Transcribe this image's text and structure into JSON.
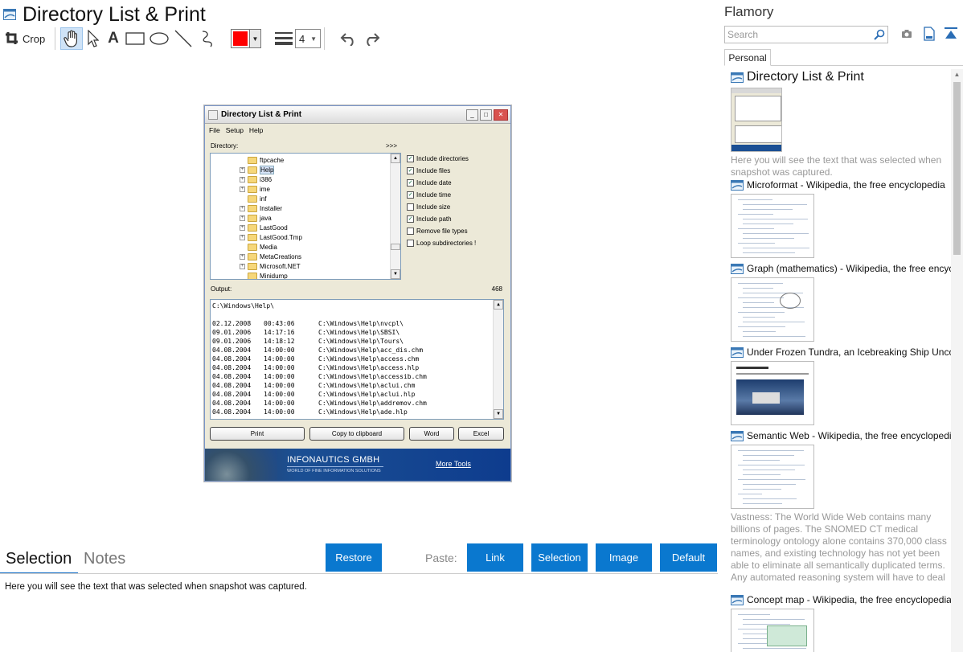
{
  "main": {
    "title": "Directory List & Print",
    "toolbar": {
      "crop_label": "Crop",
      "text_tool_glyph": "A",
      "line_width": "4",
      "color": "#ff0000"
    },
    "bottom": {
      "tab_selection": "Selection",
      "tab_notes": "Notes",
      "restore_label": "Restore",
      "paste_label": "Paste:",
      "paste_link": "Link",
      "paste_selection": "Selection",
      "paste_image": "Image",
      "paste_default": "Default",
      "selection_text": "Here you will see the text that was selected when snapshot was captured."
    }
  },
  "snapshot": {
    "title": "Directory List & Print",
    "menu": [
      "File",
      "Setup",
      "Help"
    ],
    "directory_label": "Directory:",
    "dir_arrows": ">>>",
    "tree": [
      {
        "label": "ftpcache",
        "expand": false
      },
      {
        "label": "Help",
        "expand": true,
        "selected": true
      },
      {
        "label": "i386",
        "expand": true
      },
      {
        "label": "ime",
        "expand": true
      },
      {
        "label": "inf",
        "expand": false
      },
      {
        "label": "Installer",
        "expand": true
      },
      {
        "label": "java",
        "expand": true
      },
      {
        "label": "LastGood",
        "expand": true
      },
      {
        "label": "LastGood.Tmp",
        "expand": true
      },
      {
        "label": "Media",
        "expand": false
      },
      {
        "label": "MetaCreations",
        "expand": true
      },
      {
        "label": "Microsoft.NET",
        "expand": true
      },
      {
        "label": "Minidump",
        "expand": false
      }
    ],
    "options": [
      {
        "label": "Include directories",
        "checked": true
      },
      {
        "label": "Include files",
        "checked": true
      },
      {
        "label": "Include date",
        "checked": true
      },
      {
        "label": "Include time",
        "checked": true
      },
      {
        "label": "Include size",
        "checked": false
      },
      {
        "label": "Include path",
        "checked": true
      },
      {
        "label": "Remove file types",
        "checked": false
      },
      {
        "label": "Loop subdirectories !",
        "checked": false
      }
    ],
    "output_label": "Output:",
    "output_count": "468",
    "output_header": "C:\\Windows\\Help\\",
    "output_rows": [
      {
        "date": "02.12.2008",
        "time": "00:43:06",
        "path": "C:\\Windows\\Help\\nvcpl\\"
      },
      {
        "date": "09.01.2006",
        "time": "14:17:16",
        "path": "C:\\Windows\\Help\\SBSI\\"
      },
      {
        "date": "09.01.2006",
        "time": "14:18:12",
        "path": "C:\\Windows\\Help\\Tours\\"
      },
      {
        "date": "04.08.2004",
        "time": "14:00:00",
        "path": "C:\\Windows\\Help\\acc_dis.chm"
      },
      {
        "date": "04.08.2004",
        "time": "14:00:00",
        "path": "C:\\Windows\\Help\\access.chm"
      },
      {
        "date": "04.08.2004",
        "time": "14:00:00",
        "path": "C:\\Windows\\Help\\access.hlp"
      },
      {
        "date": "04.08.2004",
        "time": "14:00:00",
        "path": "C:\\Windows\\Help\\accessib.chm"
      },
      {
        "date": "04.08.2004",
        "time": "14:00:00",
        "path": "C:\\Windows\\Help\\aclui.chm"
      },
      {
        "date": "04.08.2004",
        "time": "14:00:00",
        "path": "C:\\Windows\\Help\\aclui.hlp"
      },
      {
        "date": "04.08.2004",
        "time": "14:00:00",
        "path": "C:\\Windows\\Help\\addremov.chm"
      },
      {
        "date": "04.08.2004",
        "time": "14:00:00",
        "path": "C:\\Windows\\Help\\ade.hlp"
      }
    ],
    "buttons": [
      "Print",
      "Copy to clipboard",
      "Word",
      "Excel"
    ],
    "banner_company": "INFONAUTICS GMBH",
    "banner_tagline": "WORLD OF FINE INFORMATION SOLUTIONS",
    "banner_more": "More Tools"
  },
  "sidebar": {
    "title": "Flamory",
    "search_placeholder": "Search",
    "tab": "Personal",
    "entries": [
      {
        "title": "Directory List & Print",
        "desc": "Here you will see the text that was selected when snapshot was captured."
      },
      {
        "title": "Microformat - Wikipedia, the free encyclopedia",
        "desc": ""
      },
      {
        "title": "Graph (mathematics) - Wikipedia, the free encyclopedia",
        "desc": ""
      },
      {
        "title": "Under Frozen Tundra, an Icebreaking Ship Uncovers",
        "desc": ""
      },
      {
        "title": "Semantic Web - Wikipedia, the free encyclopedia",
        "desc": "Vastness: The World Wide Web contains many billions of pages. The SNOMED CT medical terminology ontology alone contains 370,000 class names, and existing technology has not yet been able to eliminate all semantically duplicated terms. Any automated reasoning system will have to deal with truly huge inputs."
      },
      {
        "title": "Concept map - Wikipedia, the free encyclopedia",
        "desc": ""
      }
    ]
  },
  "colors": {
    "accent": "#0a78cf",
    "selected_tool_bg": "#cfe3f7"
  }
}
